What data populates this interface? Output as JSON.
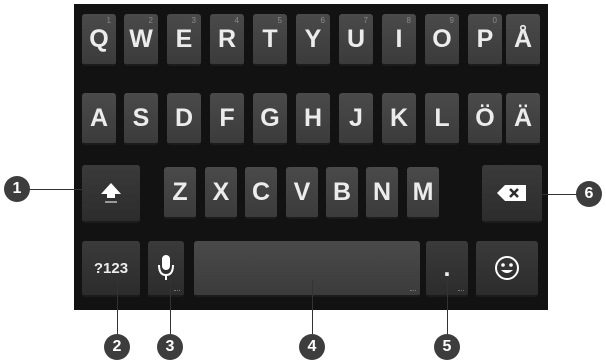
{
  "keyboard": {
    "row1": [
      {
        "label": "Q",
        "hint": "1"
      },
      {
        "label": "W",
        "hint": "2"
      },
      {
        "label": "E",
        "hint": "3"
      },
      {
        "label": "R",
        "hint": "4"
      },
      {
        "label": "T",
        "hint": "5"
      },
      {
        "label": "Y",
        "hint": "6"
      },
      {
        "label": "U",
        "hint": "7"
      },
      {
        "label": "I",
        "hint": "8"
      },
      {
        "label": "O",
        "hint": "9"
      },
      {
        "label": "P",
        "hint": "0"
      },
      {
        "label": "Å",
        "hint": ""
      }
    ],
    "row2": [
      "A",
      "S",
      "D",
      "F",
      "G",
      "H",
      "J",
      "K",
      "L",
      "Ö",
      "Ä"
    ],
    "row3": [
      "Z",
      "X",
      "C",
      "V",
      "B",
      "N",
      "M"
    ],
    "symbols_label": "?123",
    "period_label": ".",
    "icons": {
      "shift": "shift-arrow-icon",
      "backspace": "backspace-icon",
      "mic": "microphone-icon",
      "emoji": "smiley-icon"
    },
    "colors": {
      "key": "#444444",
      "background": "#121212",
      "text": "#ececec"
    }
  },
  "callouts": [
    "1",
    "2",
    "3",
    "4",
    "5",
    "6"
  ]
}
